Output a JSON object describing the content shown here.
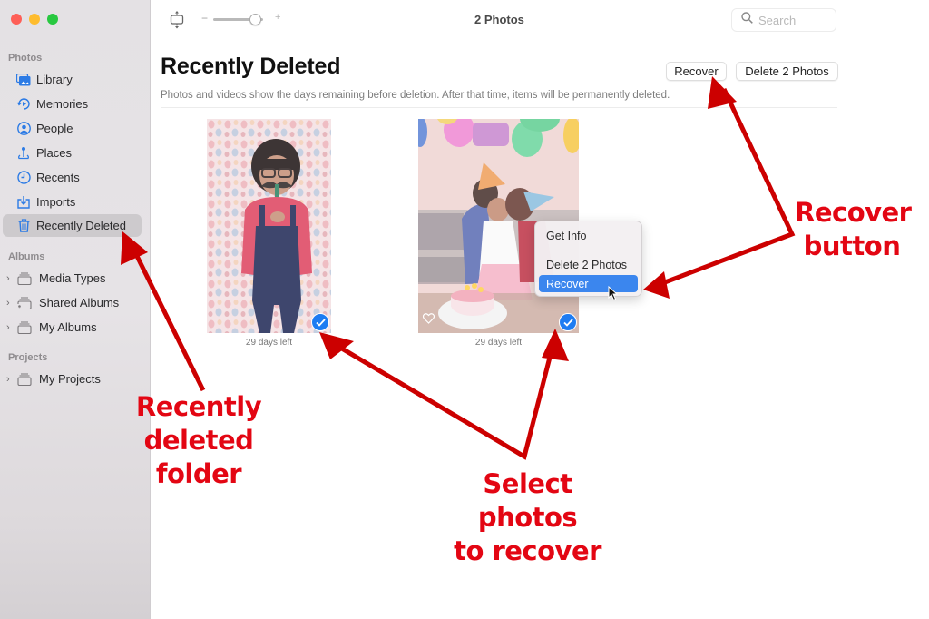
{
  "window": {
    "controls": [
      "close",
      "minimize",
      "zoom"
    ]
  },
  "sidebar": {
    "sections": [
      {
        "label": "Photos",
        "items": [
          {
            "label": "Library",
            "icon": "library-icon"
          },
          {
            "label": "Memories",
            "icon": "memories-icon"
          },
          {
            "label": "People",
            "icon": "people-icon"
          },
          {
            "label": "Places",
            "icon": "places-icon"
          },
          {
            "label": "Recents",
            "icon": "recents-icon"
          },
          {
            "label": "Imports",
            "icon": "imports-icon"
          },
          {
            "label": "Recently Deleted",
            "icon": "trash-icon",
            "selected": true
          }
        ]
      },
      {
        "label": "Albums",
        "items": [
          {
            "label": "Media Types",
            "icon": "album-stack-icon"
          },
          {
            "label": "Shared Albums",
            "icon": "shared-album-icon"
          },
          {
            "label": "My Albums",
            "icon": "album-stack-icon"
          }
        ]
      },
      {
        "label": "Projects",
        "items": [
          {
            "label": "My Projects",
            "icon": "album-stack-icon"
          }
        ]
      }
    ]
  },
  "toolbar": {
    "zoom_minus": "−",
    "zoom_plus": "+",
    "zoom_level": 0.85,
    "title": "2 Photos",
    "search_placeholder": "Search"
  },
  "main": {
    "title": "Recently Deleted",
    "subtitle": "Photos and videos show the days remaining before deletion. After that time, items will be permanently deleted.",
    "buttons": {
      "recover": "Recover",
      "delete": "Delete 2 Photos"
    },
    "photos": [
      {
        "description": "Girl in pink top and denim overalls holding a mustache prop",
        "days_left": "29 days left",
        "selected": true,
        "favorite_visible": false
      },
      {
        "description": "Birthday celebration with balloons and a cake",
        "days_left": "29 days left",
        "selected": true,
        "favorite_visible": true
      }
    ]
  },
  "context_menu": {
    "items": [
      {
        "label": "Get Info",
        "highlighted": false
      },
      {
        "label": "Delete 2 Photos",
        "highlighted": false
      },
      {
        "label": "Recover",
        "highlighted": true
      }
    ]
  },
  "annotations": {
    "color": "#e30613",
    "recover_button": [
      "Recover",
      "button"
    ],
    "recently_deleted": [
      "Recently",
      "deleted",
      "folder"
    ],
    "select_photos": [
      "Select photos",
      "to recover"
    ]
  }
}
